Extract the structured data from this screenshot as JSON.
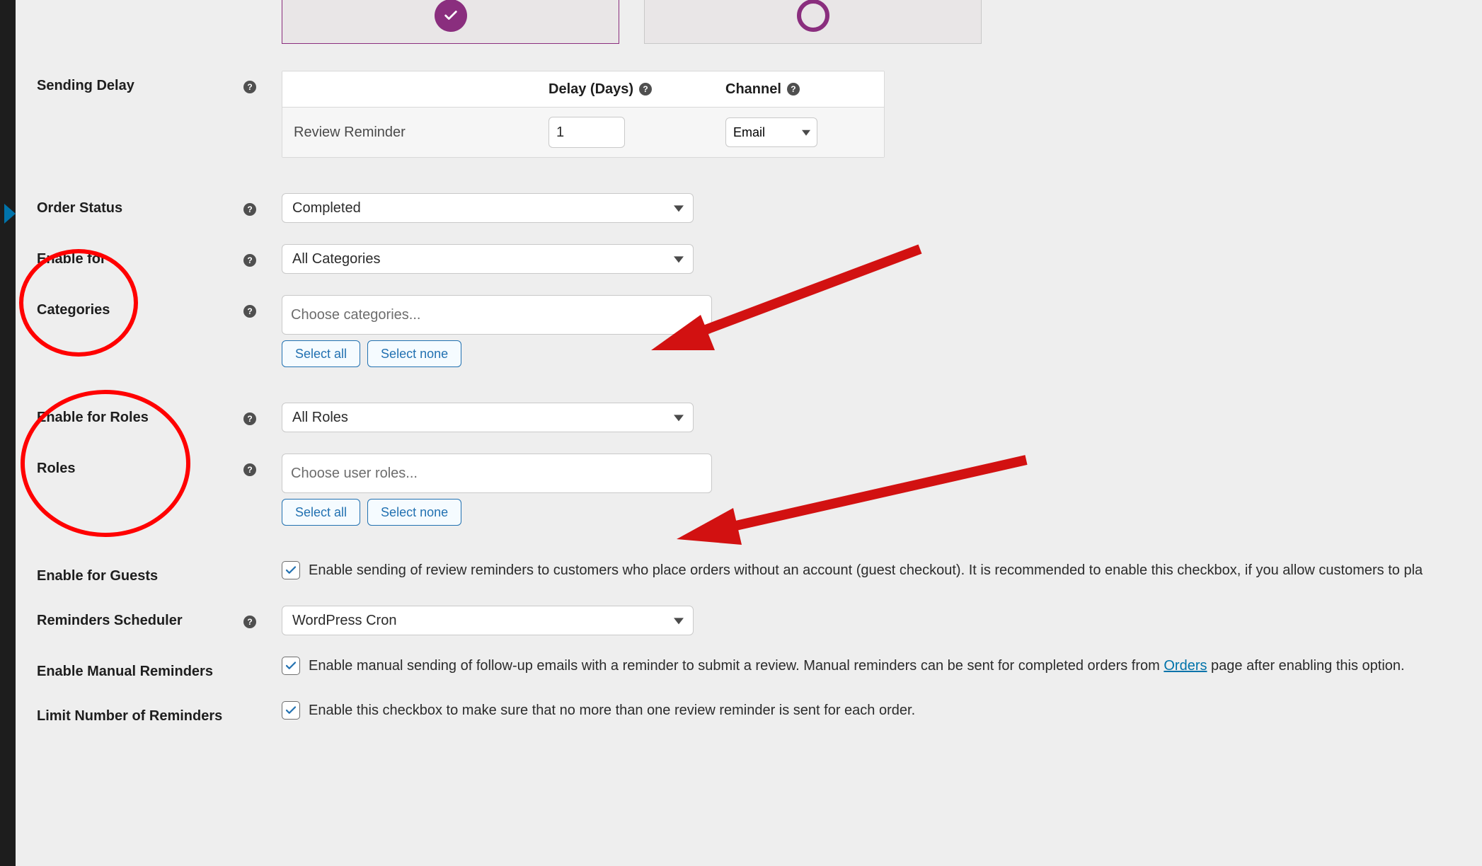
{
  "tiles": {
    "selected": true
  },
  "table": {
    "header_name": "",
    "header_delay": "Delay (Days)",
    "header_channel": "Channel",
    "row_name": "Review Reminder",
    "row_delay": "1",
    "row_channel": "Email"
  },
  "labels": {
    "sending_delay": "Sending Delay",
    "order_status": "Order Status",
    "enable_for": "Enable for",
    "categories": "Categories",
    "enable_for_roles": "Enable for Roles",
    "roles": "Roles",
    "enable_for_guests": "Enable for Guests",
    "reminders_scheduler": "Reminders Scheduler",
    "enable_manual_reminders": "Enable Manual Reminders",
    "limit_number": "Limit Number of Reminders"
  },
  "fields": {
    "order_status": "Completed",
    "enable_for": "All Categories",
    "categories_placeholder": "Choose categories...",
    "enable_for_roles": "All Roles",
    "roles_placeholder": "Choose user roles...",
    "reminders_scheduler": "WordPress Cron"
  },
  "buttons": {
    "select_all": "Select all",
    "select_none": "Select none"
  },
  "checkboxes": {
    "guests_text_a": "Enable sending of review reminders to customers who place orders without an account (guest checkout). It is recommended to enable this checkbox, if you allow customers to pla",
    "manual_text_a": "Enable manual sending of follow-up emails with a reminder to submit a review. Manual reminders can be sent for completed orders from ",
    "manual_link": "Orders",
    "manual_text_b": " page after enabling this option.",
    "limit_text": "Enable this checkbox to make sure that no more than one review reminder is sent for each order."
  }
}
